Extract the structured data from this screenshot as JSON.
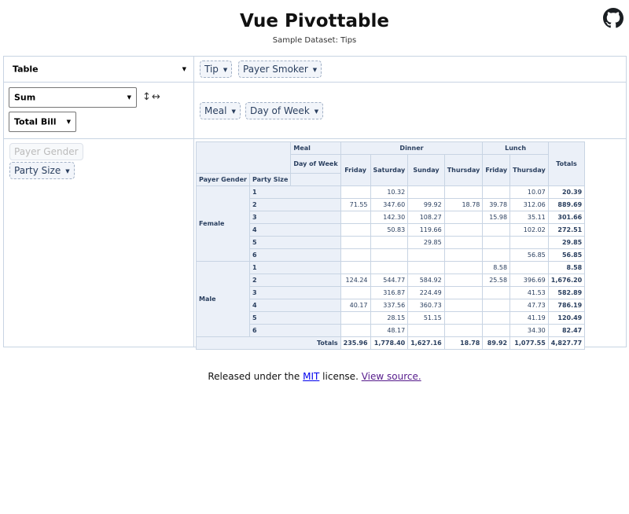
{
  "header": {
    "title": "Vue Pivottable",
    "subtitle": "Sample Dataset: Tips",
    "github_icon": "github-icon"
  },
  "controls": {
    "renderer": "Table",
    "aggregator": "Sum",
    "aggregator_attr": "Total Bill",
    "row_order_arrow": "↕",
    "col_order_arrow": "↔"
  },
  "unused_attrs": [
    {
      "label": "Tip",
      "disabled": false
    },
    {
      "label": "Payer Smoker",
      "disabled": false
    }
  ],
  "col_attrs": [
    {
      "label": "Meal"
    },
    {
      "label": "Day of Week"
    }
  ],
  "row_attrs_area": [
    {
      "label": "Payer Gender",
      "disabled": true
    },
    {
      "label": "Party Size",
      "disabled": false
    }
  ],
  "pivot": {
    "col_attr_1": "Meal",
    "col_attr_2": "Day of Week",
    "row_attr_1": "Payer Gender",
    "row_attr_2": "Party Size",
    "meals": [
      {
        "label": "Dinner",
        "span": 4
      },
      {
        "label": "Lunch",
        "span": 2
      }
    ],
    "days": [
      "Friday",
      "Saturday",
      "Sunday",
      "Thursday",
      "Friday",
      "Thursday"
    ],
    "totals_label": "Totals",
    "groups": [
      {
        "label": "Female",
        "rows": [
          {
            "size": "1",
            "cells": [
              "",
              "10.32",
              "",
              "",
              "",
              "10.07"
            ],
            "total": "20.39"
          },
          {
            "size": "2",
            "cells": [
              "71.55",
              "347.60",
              "99.92",
              "18.78",
              "39.78",
              "312.06"
            ],
            "total": "889.69"
          },
          {
            "size": "3",
            "cells": [
              "",
              "142.30",
              "108.27",
              "",
              "15.98",
              "35.11"
            ],
            "total": "301.66"
          },
          {
            "size": "4",
            "cells": [
              "",
              "50.83",
              "119.66",
              "",
              "",
              "102.02"
            ],
            "total": "272.51"
          },
          {
            "size": "5",
            "cells": [
              "",
              "",
              "29.85",
              "",
              "",
              ""
            ],
            "total": "29.85"
          },
          {
            "size": "6",
            "cells": [
              "",
              "",
              "",
              "",
              "",
              "56.85"
            ],
            "total": "56.85"
          }
        ]
      },
      {
        "label": "Male",
        "rows": [
          {
            "size": "1",
            "cells": [
              "",
              "",
              "",
              "",
              "8.58",
              ""
            ],
            "total": "8.58"
          },
          {
            "size": "2",
            "cells": [
              "124.24",
              "544.77",
              "584.92",
              "",
              "25.58",
              "396.69"
            ],
            "total": "1,676.20"
          },
          {
            "size": "3",
            "cells": [
              "",
              "316.87",
              "224.49",
              "",
              "",
              "41.53"
            ],
            "total": "582.89"
          },
          {
            "size": "4",
            "cells": [
              "40.17",
              "337.56",
              "360.73",
              "",
              "",
              "47.73"
            ],
            "total": "786.19"
          },
          {
            "size": "5",
            "cells": [
              "",
              "28.15",
              "51.15",
              "",
              "",
              "41.19"
            ],
            "total": "120.49"
          },
          {
            "size": "6",
            "cells": [
              "",
              "48.17",
              "",
              "",
              "",
              "34.30"
            ],
            "total": "82.47"
          }
        ]
      }
    ],
    "col_totals": [
      "235.96",
      "1,778.40",
      "1,627.16",
      "18.78",
      "89.92",
      "1,077.55"
    ],
    "grand_total": "4,827.77"
  },
  "footer": {
    "prefix": "Released under the ",
    "mit_link": "MIT",
    "middle": " license. ",
    "source_link": "View source."
  }
}
